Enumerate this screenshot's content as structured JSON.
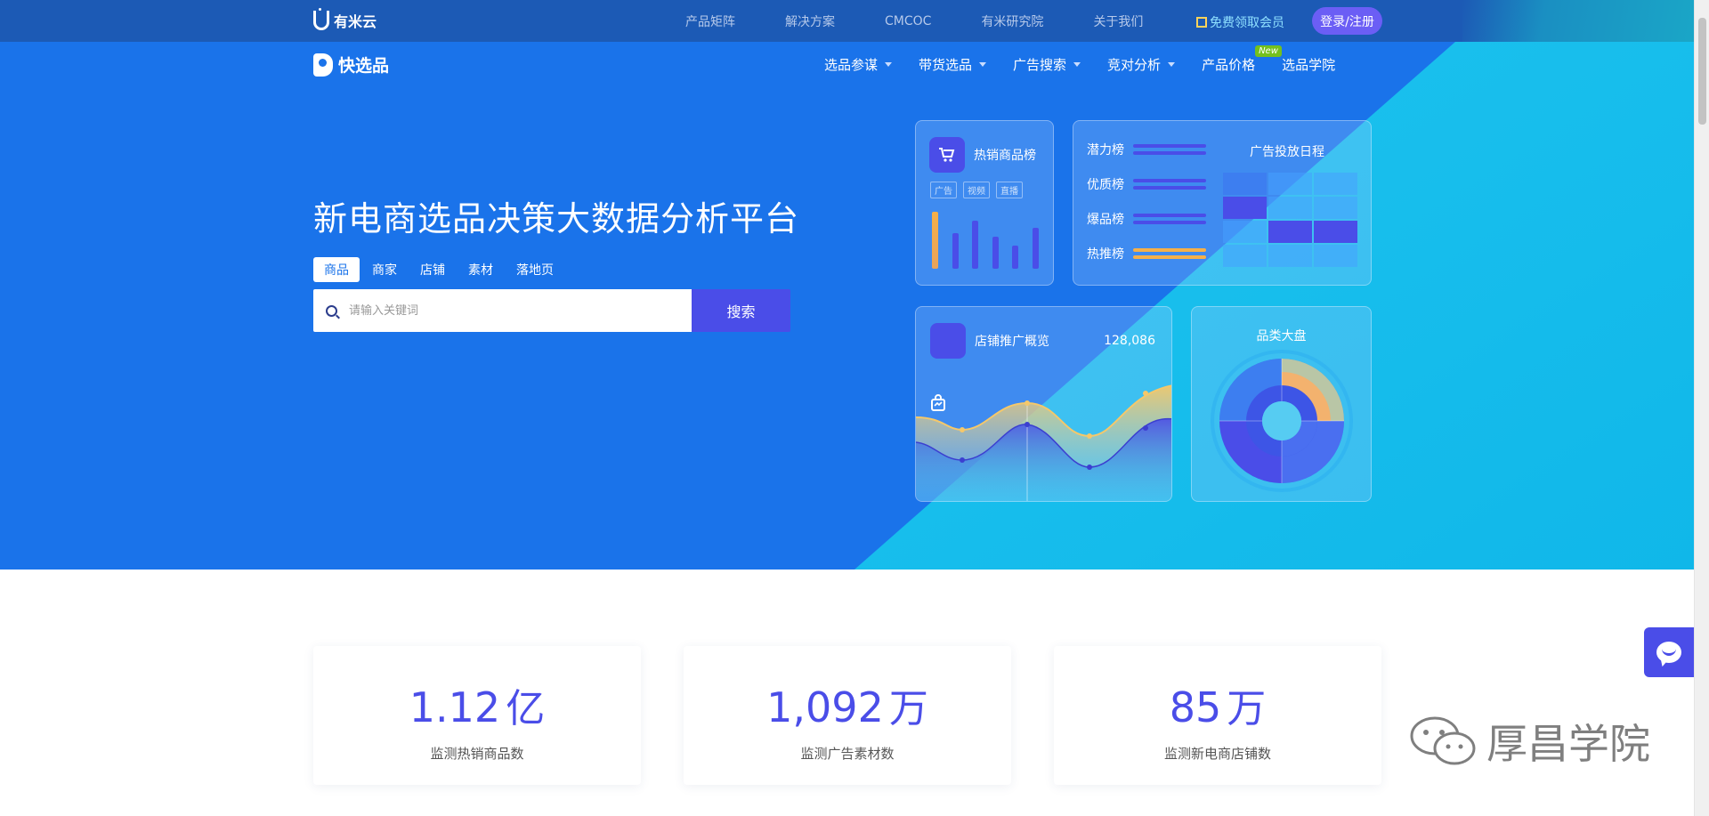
{
  "topbar": {
    "brand": "有米云",
    "links": [
      "产品矩阵",
      "解决方案",
      "CMCOC",
      "有米研究院",
      "关于我们"
    ],
    "free_member": "免费领取会员",
    "login": "登录/注册"
  },
  "nav": {
    "brand": "快选品",
    "menu": [
      {
        "label": "选品参谋",
        "caret": true
      },
      {
        "label": "带货选品",
        "caret": true
      },
      {
        "label": "广告搜索",
        "caret": true
      },
      {
        "label": "竞对分析",
        "caret": true
      },
      {
        "label": "产品价格",
        "caret": false,
        "badge": "New"
      },
      {
        "label": "选品学院",
        "caret": false
      }
    ]
  },
  "hero": {
    "title": "新电商选品决策大数据分析平台",
    "search_tabs": [
      "商品",
      "商家",
      "店铺",
      "素材",
      "落地页"
    ],
    "active_tab": "商品",
    "search_placeholder": "请输入关键词",
    "search_button": "搜索"
  },
  "cards": {
    "hot_goods": {
      "title": "热销商品榜",
      "tags": [
        "广告",
        "视频",
        "直播"
      ],
      "icon": "cart-icon"
    },
    "ranks": {
      "items": [
        "潜力榜",
        "优质榜",
        "爆品榜",
        "热推榜"
      ],
      "schedule_title": "广告投放日程"
    },
    "shop_promo": {
      "title": "店铺推广概览",
      "count": "128,086",
      "icon": "bag-icon"
    },
    "category": {
      "title": "品类大盘"
    }
  },
  "stats": [
    {
      "value": "1.12",
      "unit": "亿",
      "label": "监测热销商品数"
    },
    {
      "value": "1,092",
      "unit": "万",
      "label": "监测广告素材数"
    },
    {
      "value": "85",
      "unit": "万",
      "label": "监测新电商店铺数"
    }
  ],
  "watermark": {
    "text": "厚昌学院"
  },
  "colors": {
    "primary": "#1a73ea",
    "accent": "#4a4de8",
    "teal": "#12b9e8",
    "gold": "#f5b04a"
  }
}
